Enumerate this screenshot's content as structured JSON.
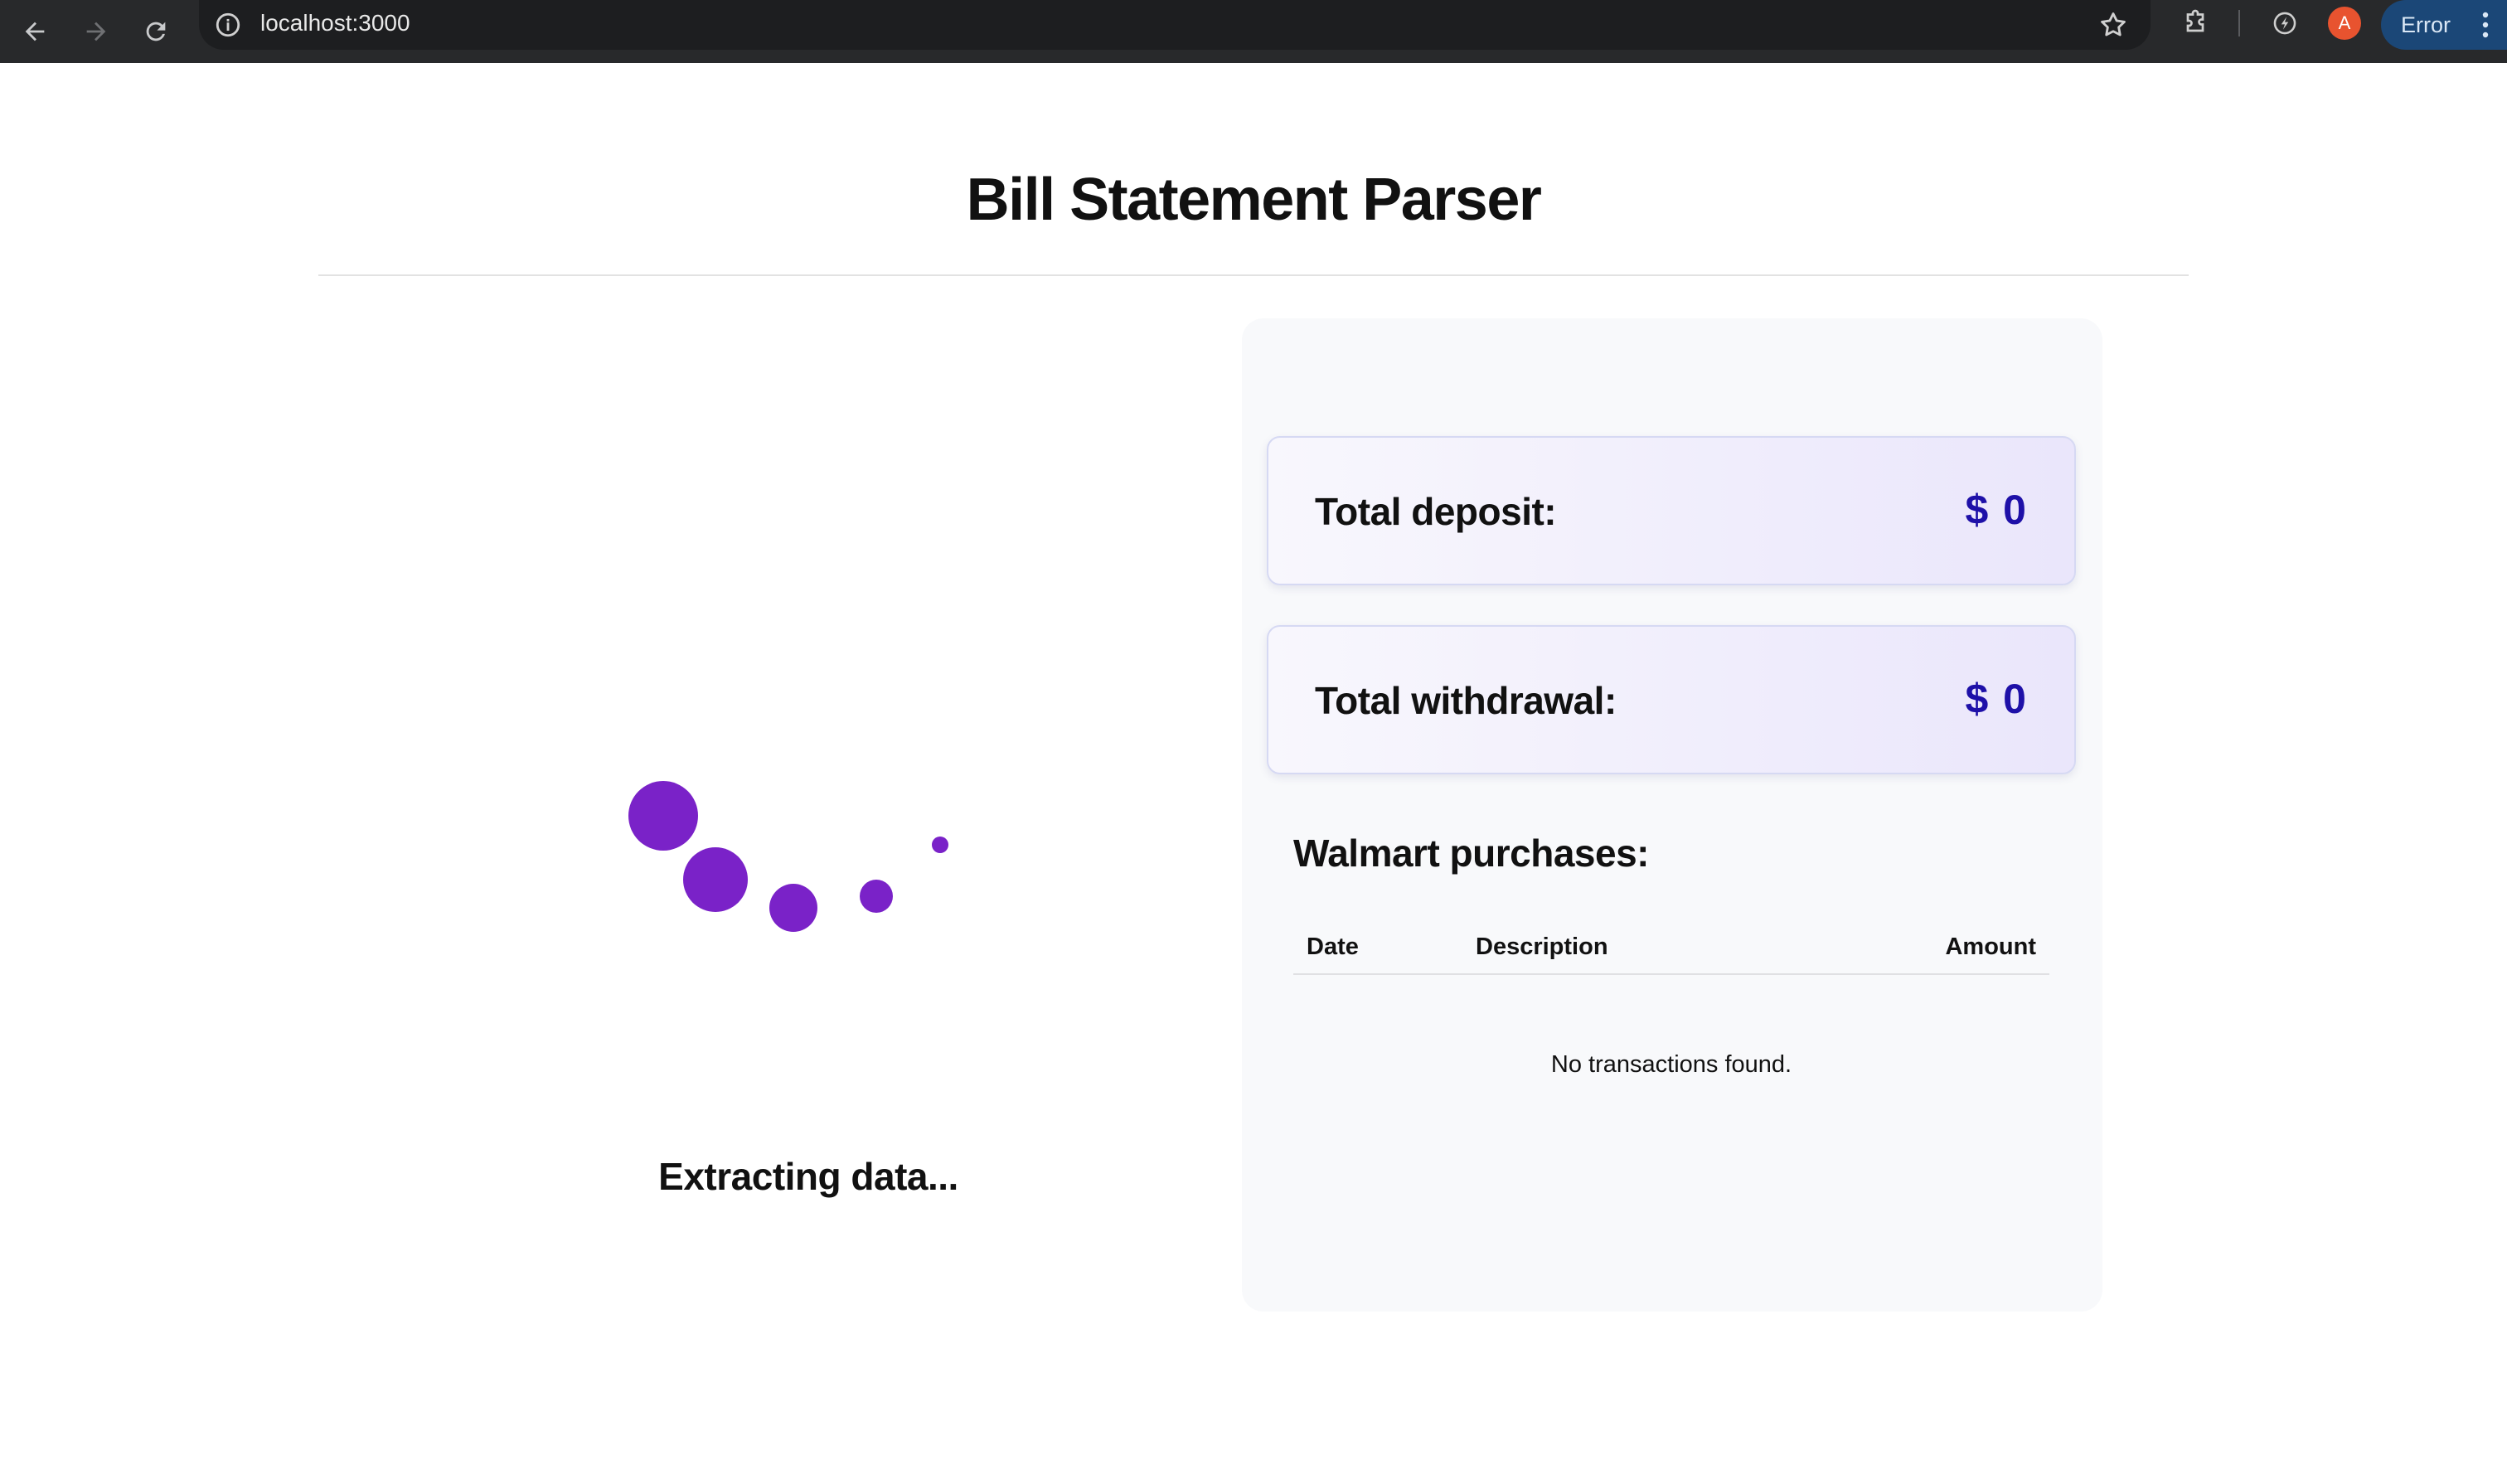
{
  "browser": {
    "url": "localhost:3000",
    "profile_initial": "A",
    "status_label": "Error"
  },
  "page": {
    "title": "Bill Statement Parser",
    "loading_text": "Extracting data..."
  },
  "summary": {
    "deposit": {
      "label": "Total deposit:",
      "value": "$ 0"
    },
    "withdrawal": {
      "label": "Total withdrawal:",
      "value": "$ 0"
    }
  },
  "purchases": {
    "title": "Walmart purchases:",
    "columns": [
      "Date",
      "Description",
      "Amount"
    ],
    "empty_message": "No transactions found.",
    "rows": []
  },
  "colors": {
    "loader": "#7a22c8",
    "amount": "#1e10a8",
    "chrome": "#28292b"
  }
}
